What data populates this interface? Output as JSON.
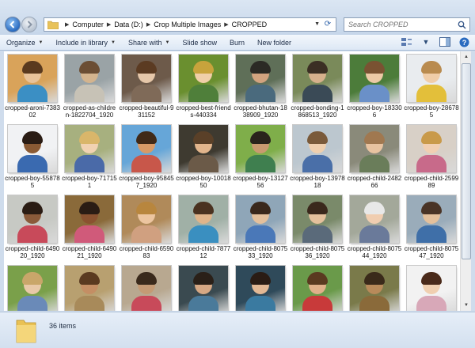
{
  "nav": {
    "breadcrumbs": [
      "Computer",
      "Data (D:)",
      "Crop Multiple Images",
      "CROPPED"
    ],
    "search_placeholder": "Search CROPPED"
  },
  "toolbar": {
    "organize": "Organize",
    "include_library": "Include in library",
    "share_with": "Share with",
    "slide_show": "Slide show",
    "burn": "Burn",
    "new_folder": "New folder"
  },
  "files": [
    {
      "name": "cropped-aroni-738302",
      "icon": "photo-child",
      "colors": [
        "#d9a35a",
        "#e8c39a",
        "#5a3a1e",
        "#3b8fc4"
      ]
    },
    {
      "name": "cropped-as-children-1822704_1920",
      "icon": "photo-child",
      "colors": [
        "#9aa3a6",
        "#d4b48e",
        "#6b4e34",
        "#c7c2b6"
      ]
    },
    {
      "name": "cropped-beautiful-931152",
      "icon": "photo-child",
      "colors": [
        "#6d5a4a",
        "#e6c7a9",
        "#5b3b22",
        "#7f6a58"
      ]
    },
    {
      "name": "cropped-best-friends-440334",
      "icon": "photo-child",
      "colors": [
        "#6a8f2f",
        "#f0cfa8",
        "#c8a33c",
        "#4f7f3a"
      ]
    },
    {
      "name": "cropped-bhutan-1838909_1920",
      "icon": "photo-child",
      "colors": [
        "#5f6f58",
        "#d2a37f",
        "#2b2a25",
        "#4a6a7d"
      ]
    },
    {
      "name": "cropped-bonding-1868513_1920",
      "icon": "photo-child",
      "colors": [
        "#7a8a5a",
        "#d6b08c",
        "#3b2f24",
        "#3a4a56"
      ]
    },
    {
      "name": "cropped-boy-183306",
      "icon": "photo-child",
      "colors": [
        "#4c7c3a",
        "#ecc9a6",
        "#7a5232",
        "#6a90c8"
      ]
    },
    {
      "name": "cropped-boy-286785",
      "icon": "photo-child",
      "colors": [
        "#e9ecef",
        "#f0cda8",
        "#b98b4f",
        "#e3bf3a"
      ]
    },
    {
      "name": "cropped-boy-558785",
      "icon": "photo-child",
      "colors": [
        "#f1f2f4",
        "#8a5a34",
        "#2a1c14",
        "#3a6ab0"
      ]
    },
    {
      "name": "cropped-boy-717151",
      "icon": "photo-child",
      "colors": [
        "#a7b07f",
        "#f1d2b2",
        "#d9b66a",
        "#4a6aa8"
      ]
    },
    {
      "name": "cropped-boy-958457_1920",
      "icon": "photo-child",
      "colors": [
        "#66a6d8",
        "#d89a66",
        "#402a18",
        "#c8574a"
      ]
    },
    {
      "name": "cropped-boy-1001850",
      "icon": "photo-child",
      "colors": [
        "#3e3a30",
        "#e2b58c",
        "#5a4028",
        "#6b5a48"
      ]
    },
    {
      "name": "cropped-boy-1312756",
      "icon": "photo-child",
      "colors": [
        "#7fae4a",
        "#c99a70",
        "#2a241c",
        "#3f7f4f"
      ]
    },
    {
      "name": "cropped-boy-1397818",
      "icon": "photo-child",
      "colors": [
        "#bcc7cf",
        "#efcfae",
        "#7a5a3a",
        "#4a6fa8"
      ]
    },
    {
      "name": "cropped-child-248266",
      "icon": "photo-child",
      "colors": [
        "#8a8a7a",
        "#e8c3a0",
        "#a07850",
        "#6a7d5a"
      ]
    },
    {
      "name": "cropped-child-259989",
      "icon": "photo-child",
      "colors": [
        "#d8d0c7",
        "#f1cfb2",
        "#c99a4a",
        "#c86a8a"
      ]
    },
    {
      "name": "cropped-child-649020_1920",
      "icon": "photo-child",
      "colors": [
        "#c7c9c4",
        "#8a5a3a",
        "#2a1c14",
        "#c84a5a"
      ]
    },
    {
      "name": "cropped-child-649021_1920",
      "icon": "photo-child",
      "colors": [
        "#8a6a3a",
        "#8a5230",
        "#2a1c14",
        "#d05a7a"
      ]
    },
    {
      "name": "cropped-child-659083",
      "icon": "photo-child",
      "colors": [
        "#b08a5a",
        "#ecc5a0",
        "#b8863e",
        "#d0a080"
      ]
    },
    {
      "name": "cropped-child-787712",
      "icon": "photo-child",
      "colors": [
        "#a0b0a6",
        "#e0b48a",
        "#4a3220",
        "#3a8fc0"
      ]
    },
    {
      "name": "cropped-child-807533_1920",
      "icon": "photo-child",
      "colors": [
        "#8fa6b8",
        "#e4c09c",
        "#3a281c",
        "#4a78b8"
      ]
    },
    {
      "name": "cropped-child-807536_1920",
      "icon": "photo-child",
      "colors": [
        "#7a8a6a",
        "#e4c09c",
        "#3a281c",
        "#5a6a7a"
      ]
    },
    {
      "name": "cropped-child-807544_1920",
      "icon": "photo-child",
      "colors": [
        "#a3a89a",
        "#f0cdb0",
        "#e8e8e8",
        "#6a7a9a"
      ]
    },
    {
      "name": "cropped-child-807547_1920",
      "icon": "photo-child",
      "colors": [
        "#9aacba",
        "#e4c09c",
        "#4a3426",
        "#3f6fa8"
      ]
    },
    {
      "name": "",
      "icon": "photo-child",
      "colors": [
        "#7aa04a",
        "#e8c8a8",
        "#c9a66a",
        "#6a8ab8"
      ]
    },
    {
      "name": "",
      "icon": "photo-child",
      "colors": [
        "#b8a070",
        "#c48e64",
        "#5a3a20",
        "#a88a5a"
      ]
    },
    {
      "name": "",
      "icon": "photo-child",
      "colors": [
        "#b8a890",
        "#c49a74",
        "#3a2a1c",
        "#c84a5a"
      ]
    },
    {
      "name": "",
      "icon": "photo-child",
      "colors": [
        "#3a4a50",
        "#d6a884",
        "#2a2018",
        "#4a7a9a"
      ]
    },
    {
      "name": "",
      "icon": "photo-child",
      "colors": [
        "#2f4a5a",
        "#e2b894",
        "#2a1c14",
        "#3a7aa0"
      ]
    },
    {
      "name": "",
      "icon": "photo-child",
      "colors": [
        "#6a9a4a",
        "#e0b08a",
        "#5a3a20",
        "#c83a3a"
      ]
    },
    {
      "name": "",
      "icon": "photo-child",
      "colors": [
        "#7a7a4a",
        "#b88a5a",
        "#3a2a1a",
        "#8a6a3a"
      ]
    },
    {
      "name": "",
      "icon": "photo-child",
      "colors": [
        "#f2f2f2",
        "#f0cfb0",
        "#4a2a1a",
        "#d8a8b8"
      ]
    }
  ],
  "status": {
    "item_count": "36 items"
  }
}
